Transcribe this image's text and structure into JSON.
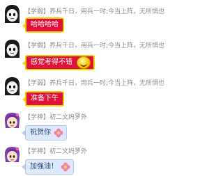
{
  "messages": [
    {
      "sender": "【学弱】养兵千日，用兵一时;今当上阵，无所惧也",
      "text": "哈哈哈哈",
      "style": "red"
    },
    {
      "sender": "【学弱】养兵千日，用兵一时;今当上阵，无所惧也",
      "text": "感觉考得不错",
      "style": "red",
      "emoji": "smiley-icon"
    },
    {
      "sender": "【学弱】养兵千日，用兵一时;今当上阵，无所惧也",
      "text": "准备下午",
      "style": "red"
    },
    {
      "sender": "【学神】初二文妈罗外",
      "text": "祝贺你",
      "style": "blue",
      "emoji": "flower-icon"
    },
    {
      "sender": "【学神】初二文妈罗外",
      "text": "加强油！",
      "style": "blue",
      "emoji": "flower-icon"
    }
  ],
  "colors": {
    "red_bubble": "#e0123c",
    "red_border": "#f6d300",
    "blue_bubble": "#dde9fb",
    "header_text": "#8c8c8c"
  }
}
